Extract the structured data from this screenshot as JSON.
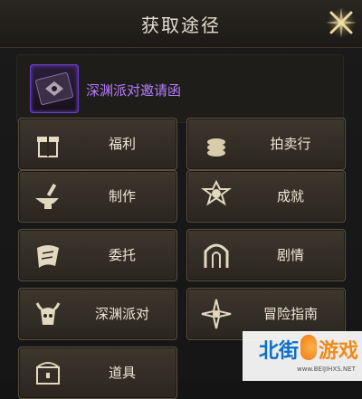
{
  "window": {
    "title": "获取途径"
  },
  "item": {
    "name": "深渊派对邀请函",
    "rarity_color": "#b67dff"
  },
  "buttons": [
    {
      "label": "福利",
      "icon": "gift-icon"
    },
    {
      "label": "拍卖行",
      "icon": "coins-icon"
    },
    {
      "label": "制作",
      "icon": "anvil-icon"
    },
    {
      "label": "成就",
      "icon": "medal-icon"
    },
    {
      "label": "委托",
      "icon": "scroll-icon"
    },
    {
      "label": "剧情",
      "icon": "gate-icon"
    },
    {
      "label": "深渊派对",
      "icon": "demon-skull-icon"
    },
    {
      "label": "冒险指南",
      "icon": "compass-icon"
    },
    {
      "label": "道具",
      "icon": "chest-icon"
    }
  ],
  "watermark": {
    "brand_left": "北街",
    "brand_right": "游戏",
    "url": "www.BEIJIHXS.NET"
  }
}
